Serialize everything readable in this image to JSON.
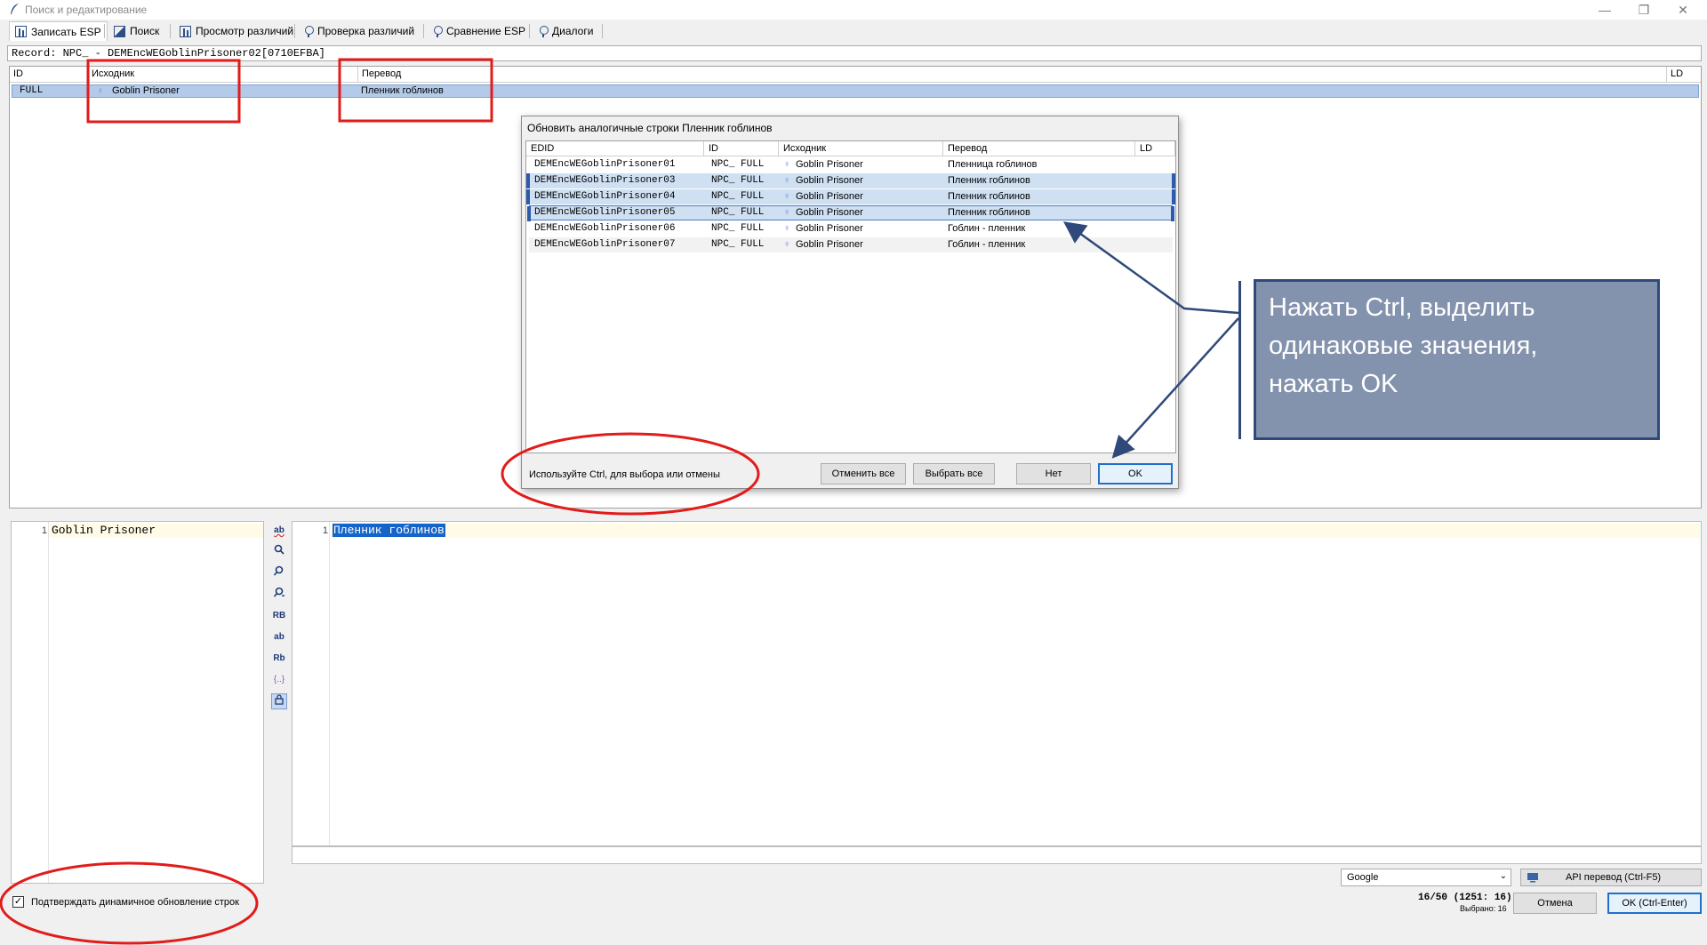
{
  "window": {
    "title": "Поиск и редактирование"
  },
  "toolbar": {
    "items": [
      "Записать ESP",
      "Поиск",
      "Просмотр различий",
      "Проверка различий",
      "Сравнение ESP",
      "Диалоги"
    ]
  },
  "record": {
    "text": "Record: NPC_ - DEMEncWEGoblinPrisoner02[0710EFBA]"
  },
  "main_table": {
    "columns": [
      "ID",
      "Исходник",
      "Перевод",
      "LD"
    ],
    "rows": [
      {
        "id": "FULL",
        "source": "Goblin Prisoner",
        "translation": "Пленник гоблинов",
        "selected": true
      }
    ]
  },
  "dialog": {
    "title": "Обновить аналогичные строки Пленник гоблинов",
    "columns": [
      "EDID",
      "ID",
      "Исходник",
      "Перевод",
      "LD"
    ],
    "rows": [
      {
        "edid": "DEMEncWEGoblinPrisoner01",
        "id": "NPC_  FULL",
        "source": "Goblin Prisoner",
        "translation": "Пленница гоблинов",
        "selected": false
      },
      {
        "edid": "DEMEncWEGoblinPrisoner03",
        "id": "NPC_  FULL",
        "source": "Goblin Prisoner",
        "translation": "Пленник гоблинов",
        "selected": true
      },
      {
        "edid": "DEMEncWEGoblinPrisoner04",
        "id": "NPC_  FULL",
        "source": "Goblin Prisoner",
        "translation": "Пленник гоблинов",
        "selected": true
      },
      {
        "edid": "DEMEncWEGoblinPrisoner05",
        "id": "NPC_  FULL",
        "source": "Goblin Prisoner",
        "translation": "Пленник гоблинов",
        "selected": true
      },
      {
        "edid": "DEMEncWEGoblinPrisoner06",
        "id": "NPC_  FULL",
        "source": "Goblin Prisoner",
        "translation": "Гоблин - пленник",
        "selected": false
      },
      {
        "edid": "DEMEncWEGoblinPrisoner07",
        "id": "NPC_  FULL",
        "source": "Goblin Prisoner",
        "translation": "Гоблин - пленник",
        "selected": false
      }
    ],
    "hint": "Используйте Ctrl, для выбора или отмены",
    "buttons": {
      "deselect_all": "Отменить все",
      "select_all": "Выбрать все",
      "no": "Нет",
      "ok": "OK"
    }
  },
  "annotation": {
    "text": "Нажать Ctrl, выделить\n одинаковые значения,\nнажать OK"
  },
  "editor": {
    "source_line_number": "1",
    "source_text": "Goblin Prisoner",
    "target_line_number": "1",
    "target_text": "Пленник гоблинов"
  },
  "tools": [
    "ab",
    "search-icon",
    "search-plus-icon",
    "search-replace-icon",
    "RB",
    "ab",
    "Rb",
    "{..}",
    "lock-icon"
  ],
  "bottom": {
    "engine": "Google",
    "api_button": "API перевод (Ctrl-F5)",
    "confirm_label": "Подтверждать динамичное обновление строк",
    "confirm_checked": true,
    "counter": "16/50  (1251: 16)",
    "selected_label": "Выбрано: 16",
    "cancel": "Отмена",
    "ok": "OK (Ctrl-Enter)"
  },
  "colors": {
    "accent": "#1f6fd0",
    "selection": "#cfe0f3",
    "annotation_red": "#e21b1b",
    "note_bg": "#8393ad",
    "note_border": "#2f4a7a"
  }
}
